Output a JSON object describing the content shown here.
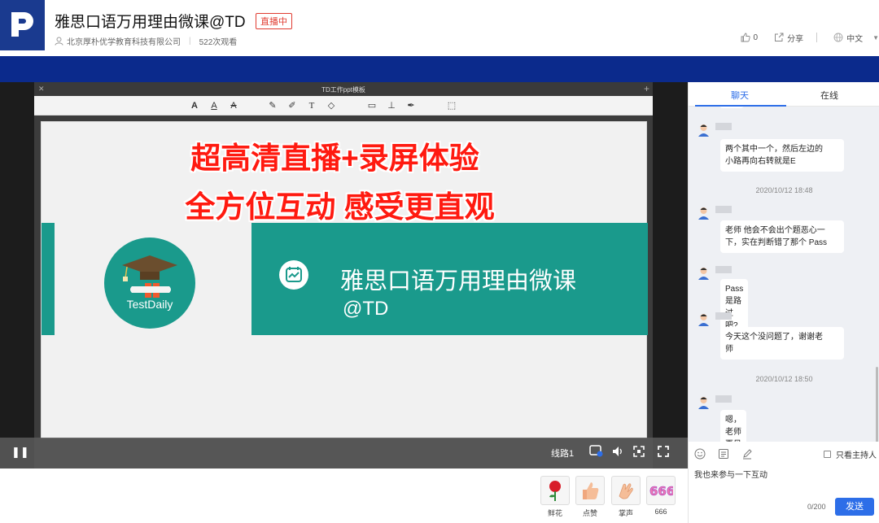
{
  "header": {
    "title": "雅思口语万用理由微课@TD",
    "live_badge": "直播中",
    "org": "北京厚朴优学教育科技有限公司",
    "views": "522次观看",
    "likes": "0",
    "share": "分享",
    "language": "中文"
  },
  "ppt": {
    "window_title": "TD工作ppt模板",
    "headline1": "超高清直播+录屏体验",
    "headline2": "全方位互动 感受更直观",
    "brand": "TestDaily",
    "course_title": "雅思口语万用理由微课",
    "course_sub": "@TD"
  },
  "controls": {
    "line": "线路1"
  },
  "gifts": [
    {
      "label": "鲜花"
    },
    {
      "label": "点赞"
    },
    {
      "label": "掌声"
    },
    {
      "label": "666"
    }
  ],
  "chat": {
    "tabs": {
      "chat": "聊天",
      "online": "在线"
    },
    "messages": [
      {
        "text_l1": "两个其中一个，然后左边的",
        "text_l2": "小路再向右转就是E"
      },
      {
        "text_l1": "老师 他会不会出个题恶心一",
        "text_l2": "下，实在判断错了那个 Pass"
      },
      {
        "text_l1": "Pass 是路过 吧?"
      },
      {
        "text_l1": "今天这个没问题了，谢谢老",
        "text_l2": "师"
      },
      {
        "text_l1": "嗯，老师再见"
      }
    ],
    "times": [
      "2020/10/12 18:48",
      "2020/10/12 18:50"
    ],
    "only_host": "只看主持人",
    "draft": "我也来参与一下互动",
    "counter": "0/200",
    "send": "发送"
  },
  "colors": {
    "brand_blue": "#1a3a8f",
    "teal": "#1a9a8c",
    "accent_blue": "#2d6ee8",
    "live_red": "#e03c31",
    "headline_red": "#ff1a10"
  }
}
